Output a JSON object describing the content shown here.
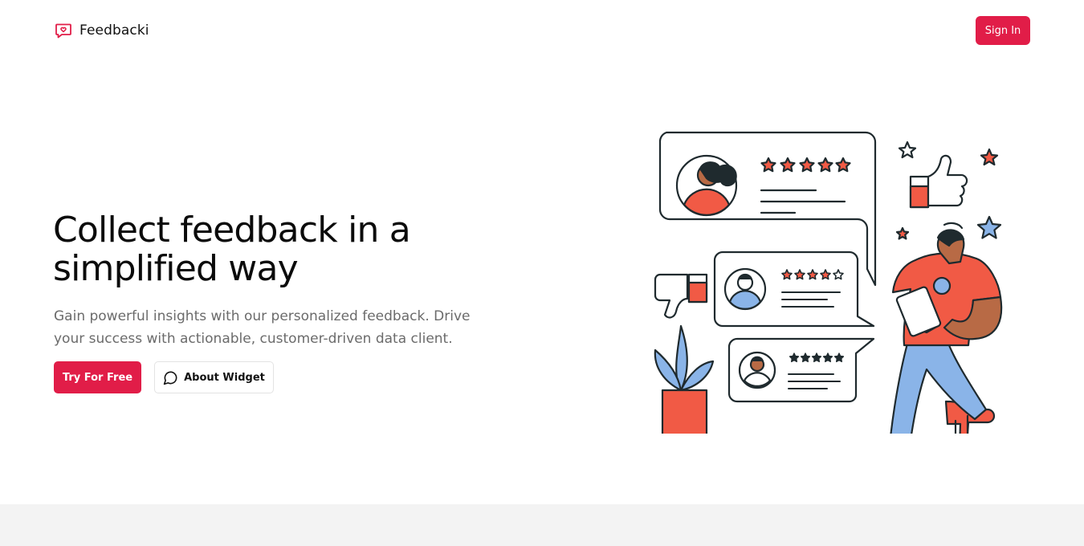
{
  "brand": {
    "name": "Feedbacki",
    "icon": "chat-heart-icon"
  },
  "nav": {
    "signin_label": "Sign In"
  },
  "hero": {
    "title": "Collect feedback in a simplified way",
    "subtitle": "Gain powerful insights with our personalized feedback. Drive your success with actionable, customer-driven data client.",
    "primary_cta": "Try For Free",
    "secondary_cta": "About Widget",
    "secondary_icon": "message-circle-icon"
  },
  "colors": {
    "accent": "#e11d48",
    "illustration_red": "#f15a45",
    "illustration_blue": "#8ab4e8",
    "ink": "#1f2a2e",
    "footer_band": "#f3f3f3"
  },
  "illustration": {
    "subject": "person with tablet beside review cards, stars, thumbs up/down and potted plant",
    "review_cards": [
      {
        "stars": 5
      },
      {
        "stars": 5
      },
      {
        "stars": 5
      }
    ]
  }
}
